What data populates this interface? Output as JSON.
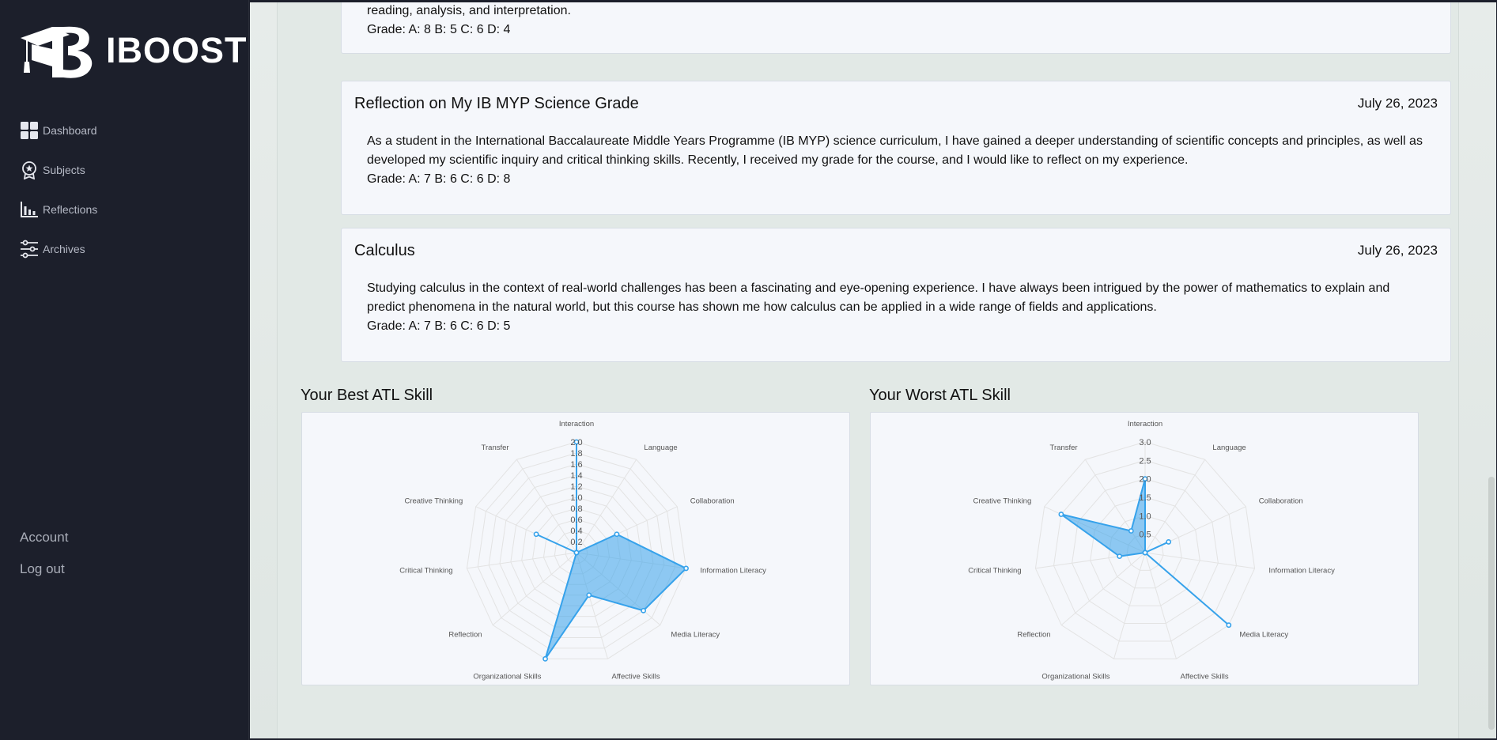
{
  "app": {
    "name": "IBOOST"
  },
  "nav": [
    {
      "label": "Dashboard",
      "icon": "dashboard-icon"
    },
    {
      "label": "Subjects",
      "icon": "award-icon"
    },
    {
      "label": "Reflections",
      "icon": "bar-chart-icon"
    },
    {
      "label": "Archives",
      "icon": "sliders-icon"
    }
  ],
  "account": {
    "account_label": "Account",
    "logout_label": "Log out"
  },
  "reflections": [
    {
      "title": "",
      "date": "",
      "body": "reading, analysis, and interpretation.",
      "grade": "Grade: A: 8 B: 5 C: 6 D: 4"
    },
    {
      "title": "Reflection on My IB MYP Science Grade",
      "date": "July 26, 2023",
      "body": "As a student in the International Baccalaureate Middle Years Programme (IB MYP) science curriculum, I have gained a deeper understanding of scientific concepts and principles, as well as developed my scientific inquiry and critical thinking skills. Recently, I received my grade for the course, and I would like to reflect on my experience.",
      "grade": "Grade: A: 7 B: 6 C: 6 D: 8"
    },
    {
      "title": "Calculus",
      "date": "July 26, 2023",
      "body": "Studying calculus in the context of real-world challenges has been a fascinating and eye-opening experience. I have always been intrigued by the power of mathematics to explain and predict phenomena in the natural world, but this course has shown me how calculus can be applied in a wide range of fields and applications.",
      "grade": "Grade: A: 7 B: 6 C: 6 D: 5"
    }
  ],
  "atl": {
    "best_title": "Your Best ATL Skill",
    "worst_title": "Your Worst ATL Skill"
  },
  "colors": {
    "accent": "#36a2eb",
    "fill": "rgba(54,162,235,0.55)",
    "sidebar": "#1c1f2b"
  },
  "chart_data": [
    {
      "type": "radar",
      "title": "Your Best ATL Skill",
      "categories": [
        "Interaction",
        "Language",
        "Collaboration",
        "Information Literacy",
        "Media Literacy",
        "Affective Skills",
        "Organizational Skills",
        "Reflection",
        "Critical Thinking",
        "Creative Thinking",
        "Transfer"
      ],
      "values": [
        2.0,
        0,
        0.8,
        2.0,
        1.6,
        0.8,
        2.0,
        0,
        0,
        0.8,
        0
      ],
      "ylim": [
        0,
        2.0
      ],
      "ticks": [
        "0.2",
        "0.4",
        "0.6",
        "0.8",
        "1.0",
        "1.2",
        "1.4",
        "1.6",
        "1.8",
        "2.0"
      ]
    },
    {
      "type": "radar",
      "title": "Your Worst ATL Skill",
      "categories": [
        "Interaction",
        "Language",
        "Collaboration",
        "Information Literacy",
        "Media Literacy",
        "Affective Skills",
        "Organizational Skills",
        "Reflection",
        "Critical Thinking",
        "Creative Thinking",
        "Transfer"
      ],
      "values": [
        2.0,
        0,
        0.7,
        0,
        3.0,
        0,
        0,
        0,
        0.7,
        2.5,
        0.7
      ],
      "ylim": [
        0,
        3.0
      ],
      "ticks": [
        "0.5",
        "1.0",
        "1.5",
        "2.0",
        "2.5",
        "3.0"
      ]
    }
  ]
}
